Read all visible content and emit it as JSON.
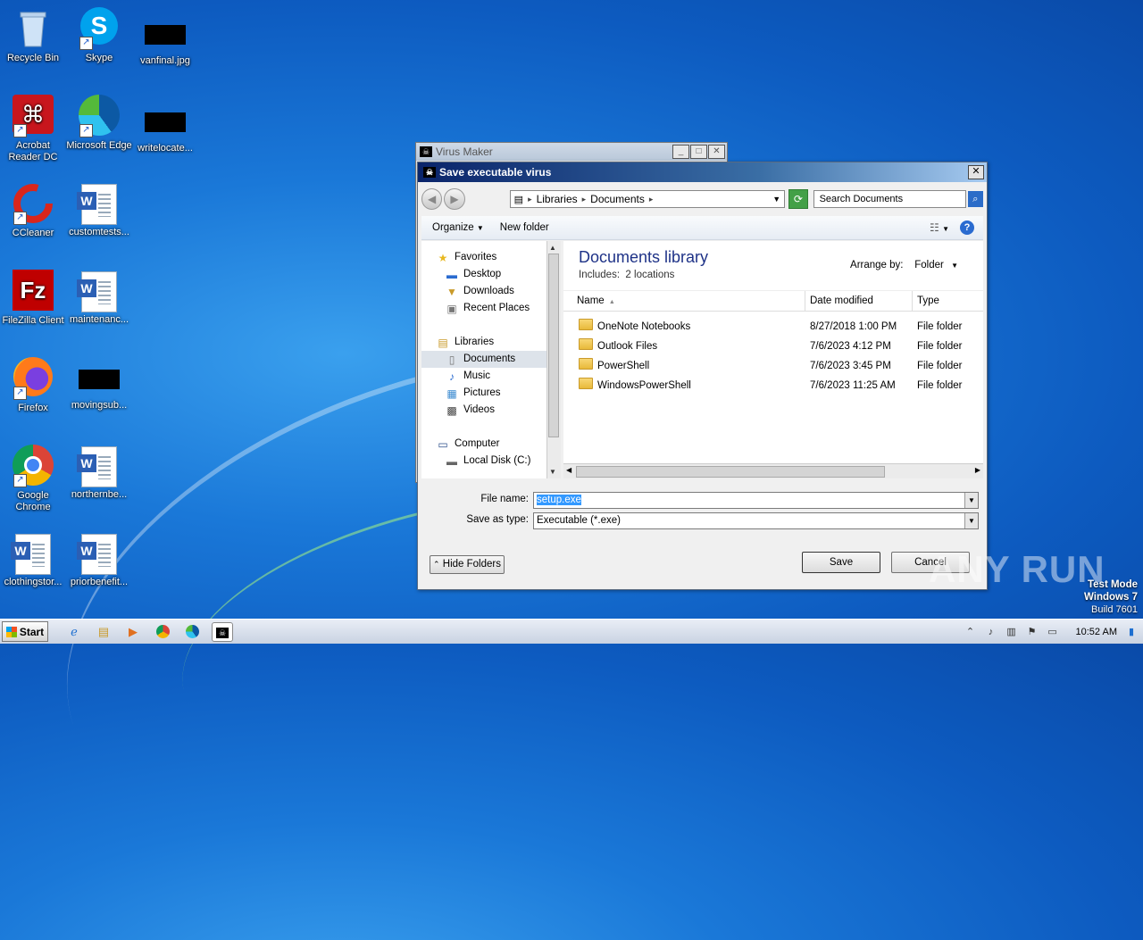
{
  "desktop": {
    "icons": [
      {
        "label": "Recycle Bin"
      },
      {
        "label": "Skype"
      },
      {
        "label": "vanfinal.jpg"
      },
      {
        "label": "Acrobat Reader DC"
      },
      {
        "label": "Microsoft Edge"
      },
      {
        "label": "writelocate..."
      },
      {
        "label": "CCleaner"
      },
      {
        "label": "customtests..."
      },
      {
        "label": "FileZilla Client"
      },
      {
        "label": "maintenanc..."
      },
      {
        "label": "Firefox"
      },
      {
        "label": "movingsub..."
      },
      {
        "label": "Google Chrome"
      },
      {
        "label": "northernbe..."
      },
      {
        "label": "clothingstor..."
      },
      {
        "label": "priorbenefit..."
      }
    ]
  },
  "bg_window": {
    "title": "Virus Maker"
  },
  "dialog": {
    "title": "Save executable virus",
    "breadcrumb": [
      "Libraries",
      "Documents"
    ],
    "search_placeholder": "Search Documents",
    "toolbar": {
      "organize": "Organize",
      "new_folder": "New folder"
    },
    "nav": {
      "favorites": "Favorites",
      "desktop": "Desktop",
      "downloads": "Downloads",
      "recent": "Recent Places",
      "libraries": "Libraries",
      "documents": "Documents",
      "music": "Music",
      "pictures": "Pictures",
      "videos": "Videos",
      "computer": "Computer",
      "local_disk": "Local Disk (C:)"
    },
    "library_title": "Documents library",
    "library_includes_label": "Includes:",
    "library_includes_link": "2 locations",
    "arrange_label": "Arrange by:",
    "arrange_value": "Folder",
    "columns": {
      "name": "Name",
      "date": "Date modified",
      "type": "Type"
    },
    "files": [
      {
        "name": "OneNote Notebooks",
        "date": "8/27/2018 1:00 PM",
        "type": "File folder"
      },
      {
        "name": "Outlook Files",
        "date": "7/6/2023 4:12 PM",
        "type": "File folder"
      },
      {
        "name": "PowerShell",
        "date": "7/6/2023 3:45 PM",
        "type": "File folder"
      },
      {
        "name": "WindowsPowerShell",
        "date": "7/6/2023 11:25 AM",
        "type": "File folder"
      }
    ],
    "file_name_label": "File name:",
    "file_name_value": "setup.exe",
    "save_type_label": "Save as type:",
    "save_type_value": "Executable (*.exe)",
    "hide_folders": "Hide Folders",
    "save": "Save",
    "cancel": "Cancel"
  },
  "taskbar": {
    "start": "Start",
    "time": "10:52 AM"
  },
  "watermark": "ANY RUN",
  "test_mode": {
    "line1": "Test Mode",
    "line2": "Windows 7",
    "line3": "Build 7601"
  }
}
